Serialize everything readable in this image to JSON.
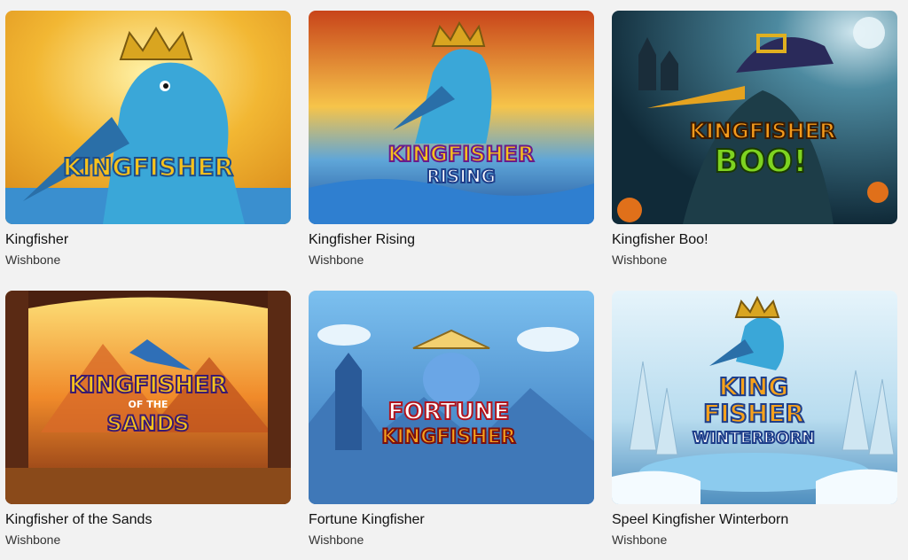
{
  "games": [
    {
      "title": "Kingfisher",
      "provider": "Wishbone",
      "logo": [
        "KINGFISHER"
      ],
      "bg": [
        "#f2b733",
        "#3aa7d8"
      ]
    },
    {
      "title": "Kingfisher Rising",
      "provider": "Wishbone",
      "logo": [
        "KINGFISHER",
        "RISING"
      ],
      "bg": [
        "#e05a1a",
        "#2b6fc4"
      ]
    },
    {
      "title": "Kingfisher Boo!",
      "provider": "Wishbone",
      "logo": [
        "KINGFISHER",
        "BOO!"
      ],
      "bg": [
        "#2f5a6e",
        "#123040"
      ]
    },
    {
      "title": "Kingfisher of the Sands",
      "provider": "Wishbone",
      "logo": [
        "KINGFISHER",
        "OF THE",
        "SANDS"
      ],
      "bg": [
        "#f3b23a",
        "#c2431c"
      ]
    },
    {
      "title": "Fortune Kingfisher",
      "provider": "Wishbone",
      "logo": [
        "FORTUNE",
        "KINGFISHER"
      ],
      "bg": [
        "#6fb2e8",
        "#2f6fb7"
      ]
    },
    {
      "title": "Speel Kingfisher Winterborn",
      "provider": "Wishbone",
      "logo": [
        "KING",
        "FISHER",
        "WINTERBORN"
      ],
      "bg": [
        "#bfe3f5",
        "#6fa9cf"
      ]
    }
  ]
}
